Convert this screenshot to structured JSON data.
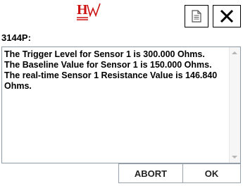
{
  "window": {
    "title": "3144P:",
    "logo_text": "HW",
    "toolbar": {
      "document_icon": "document-icon",
      "close_icon": "close-icon"
    }
  },
  "message": {
    "lines": [
      "The Trigger Level for Sensor 1 is 300.000 Ohms.",
      "The Baseline Value for Sensor 1 is 150.000 Ohms.",
      "The real-time Sensor 1 Resistance Value is 146.840 Ohms."
    ]
  },
  "buttons": {
    "abort_label": "ABORT",
    "ok_label": "OK"
  },
  "colors": {
    "logo_red": "#cc1111",
    "border": "#9aa3ab"
  }
}
